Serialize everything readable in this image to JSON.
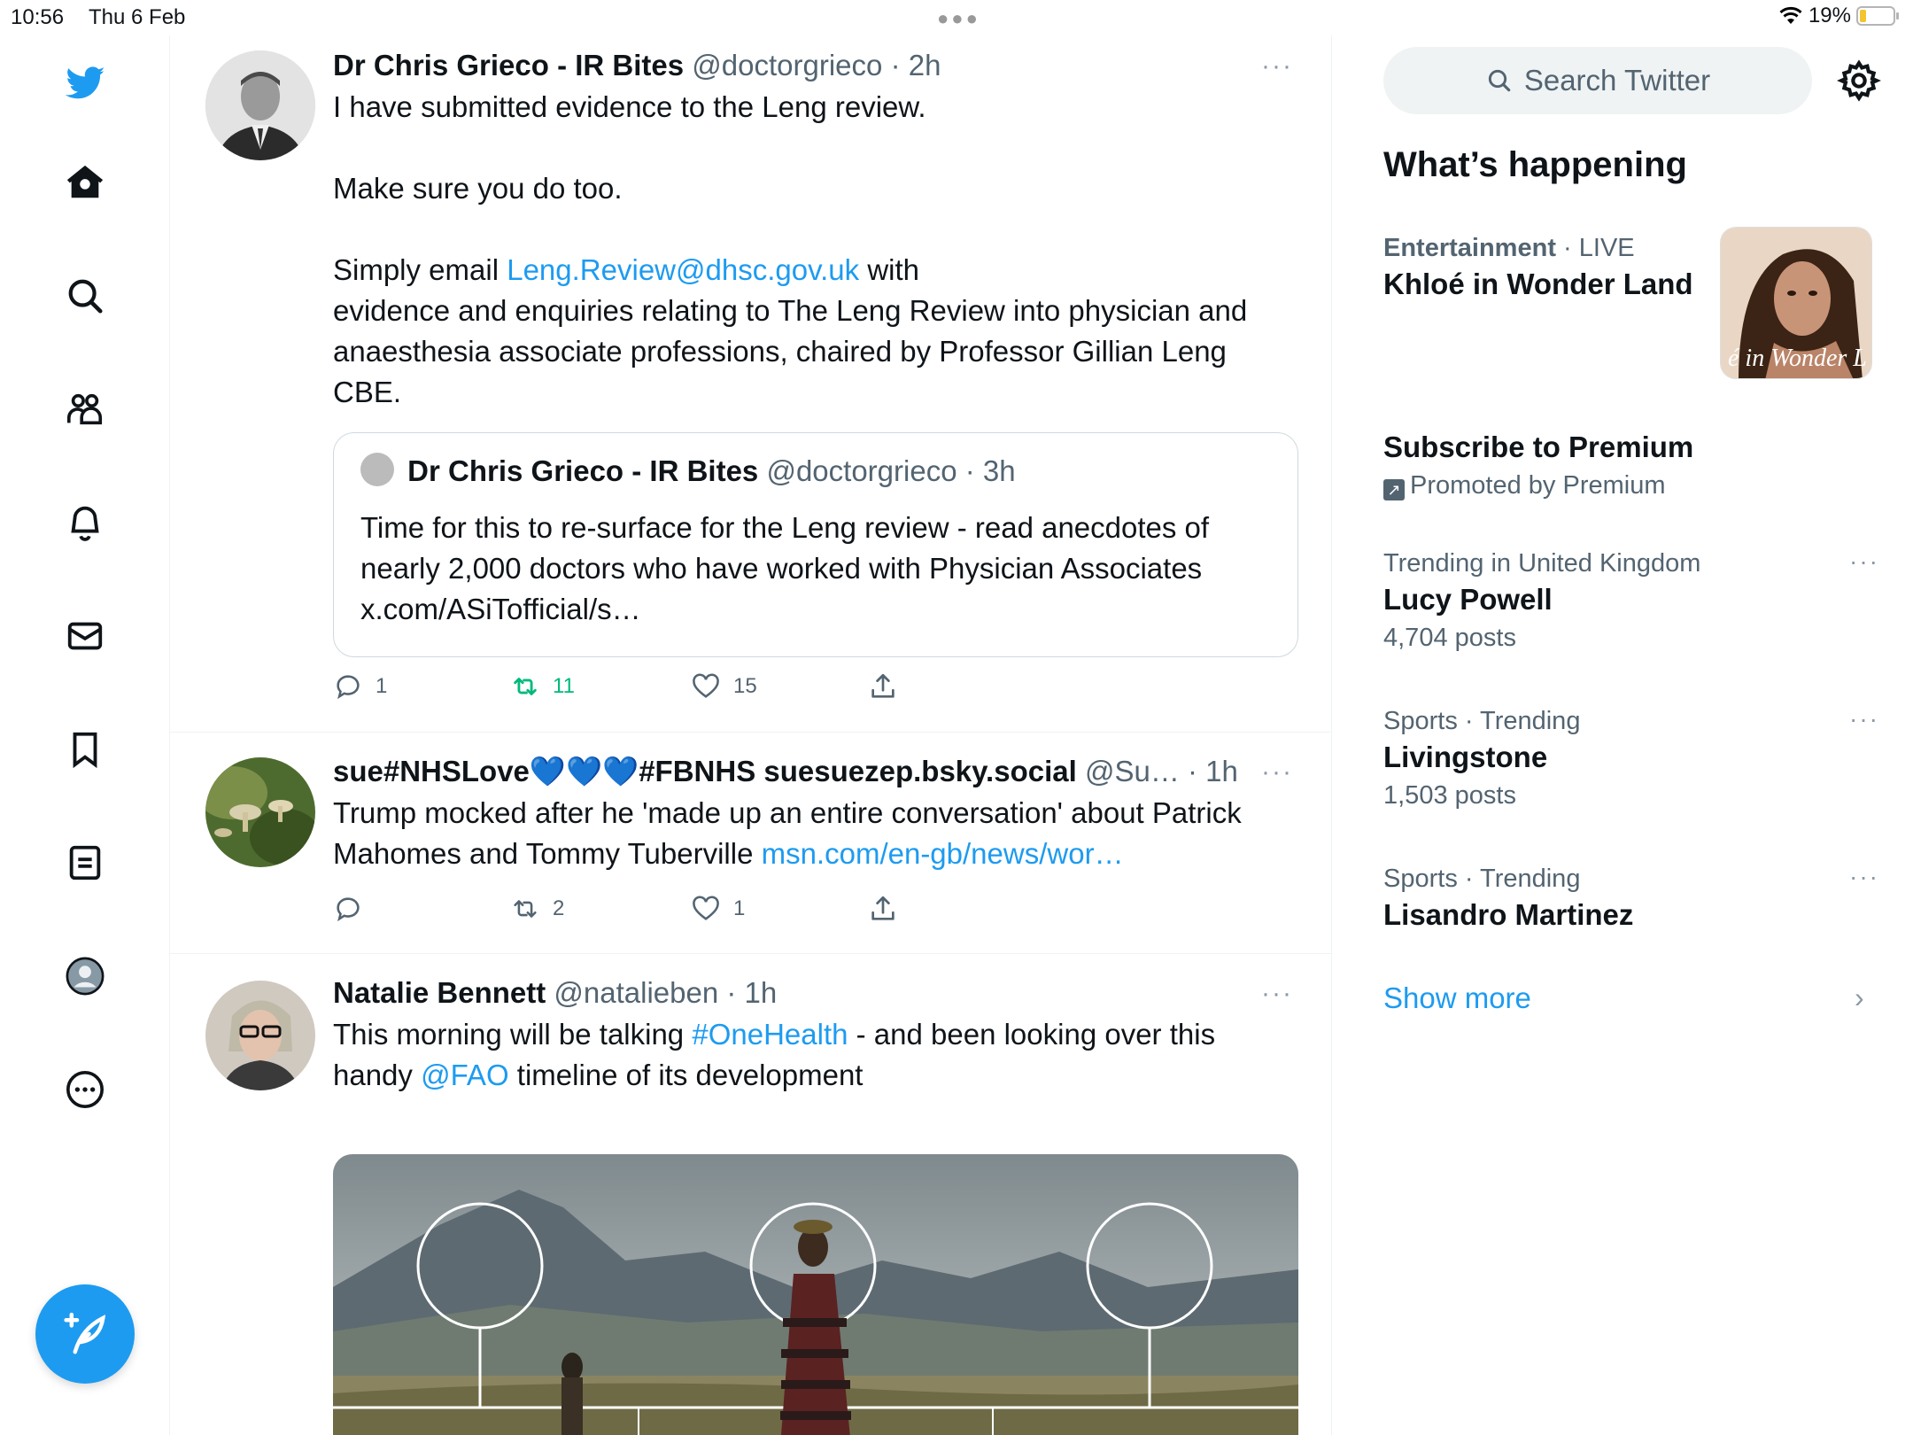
{
  "status_bar": {
    "time": "10:56",
    "date": "Thu 6 Feb",
    "battery": "19%",
    "battery_level": 0.19
  },
  "colors": {
    "accent": "#1d9bf0",
    "retweet_active": "#00ba7c",
    "text": "#0f1419",
    "muted": "#536471"
  },
  "nav": {
    "icons": [
      "twitter-logo",
      "home-icon",
      "search-icon",
      "communities-icon",
      "notifications-icon",
      "messages-icon",
      "bookmarks-icon",
      "lists-icon",
      "profile-icon",
      "more-icon"
    ],
    "compose": "compose-icon"
  },
  "tweets": [
    {
      "name": "Dr Chris Grieco - IR Bites",
      "handle": "@doctorgrieco",
      "time": "· 2h",
      "more": "···",
      "text_p1": "I have submitted evidence to the Leng review.",
      "text_p2": "Make sure you do too.",
      "text_p3_pre": "Simply email ",
      "text_p3_link": "Leng.Review@dhsc.gov.uk",
      "text_p3_post": " with",
      "text_p4": "evidence and enquiries relating to The Leng Review into physician and anaesthesia associate professions, chaired by Professor Gillian Leng CBE.",
      "quote": {
        "name": "Dr Chris Grieco - IR Bites",
        "handle": "@doctorgrieco",
        "time": "· 3h",
        "text": "Time for this to re-surface for the Leng review - read anecdotes of nearly 2,000 doctors who have worked with Physician Associates x.com/ASiTofficial/s…"
      },
      "replies": "1",
      "retweets": "11",
      "likes": "15"
    },
    {
      "name_pre": "sue#NHSLove",
      "name_post": "#FBNHS suesuezep.bsky.social",
      "handle": "@Su…",
      "time": "· 1h",
      "more": "···",
      "text_pre": "Trump mocked after he 'made up an entire conversation' about Patrick Mahomes and Tommy Tuberville ",
      "text_link": "msn.com/en-gb/news/wor…",
      "replies": "",
      "retweets": "2",
      "likes": "1"
    },
    {
      "name": "Natalie Bennett",
      "handle": "@natalieben",
      "time": "· 1h",
      "more": "···",
      "text_a": "This morning will be talking ",
      "hashtag": "#OneHealth",
      "text_b": " - and been looking over this handy ",
      "mention": "@FAO",
      "text_c": " timeline of its development"
    }
  ],
  "sidebar": {
    "search_placeholder": "Search Twitter",
    "title": "What’s happening",
    "trends": [
      {
        "category": "Entertainment",
        "live": "· LIVE",
        "title": "Khloé in Wonder Land",
        "image_caption": "é in Wonder L"
      },
      {
        "title": "Subscribe to Premium",
        "promoted": "Promoted by Premium"
      },
      {
        "category": "Trending in United Kingdom",
        "title": "Lucy Powell",
        "count": "4,704 posts"
      },
      {
        "category": "Sports · Trending",
        "title": "Livingstone",
        "count": "1,503 posts"
      },
      {
        "category": "Sports · Trending",
        "title": "Lisandro Martinez"
      }
    ],
    "show_more": "Show more"
  }
}
